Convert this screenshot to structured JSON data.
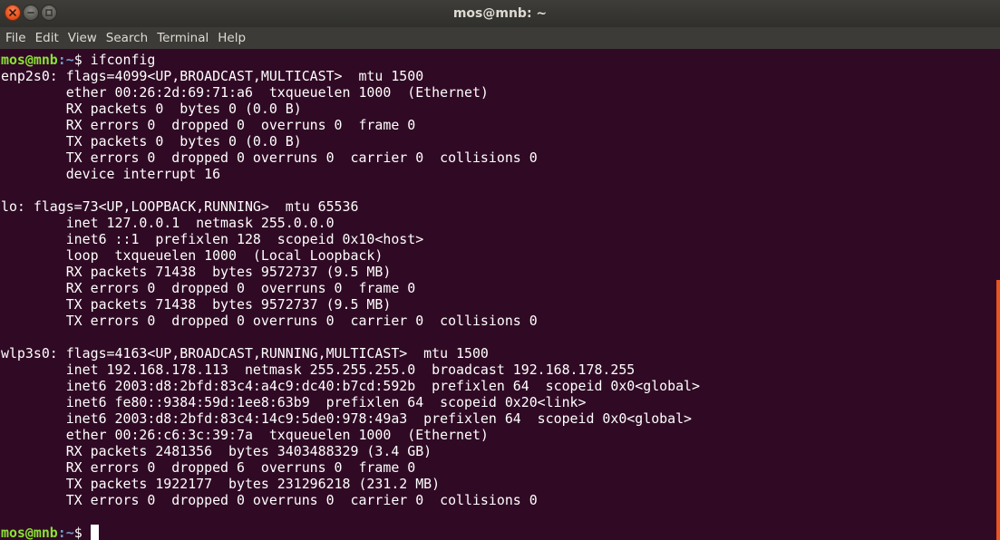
{
  "window": {
    "title": "mos@mnb: ~"
  },
  "menu": [
    "File",
    "Edit",
    "View",
    "Search",
    "Terminal",
    "Help"
  ],
  "prompt": {
    "user_host": "mos@mnb",
    "path": ":~",
    "symbol": "$ "
  },
  "command": "ifconfig",
  "output": [
    "enp2s0: flags=4099<UP,BROADCAST,MULTICAST>  mtu 1500",
    "        ether 00:26:2d:69:71:a6  txqueuelen 1000  (Ethernet)",
    "        RX packets 0  bytes 0 (0.0 B)",
    "        RX errors 0  dropped 0  overruns 0  frame 0",
    "        TX packets 0  bytes 0 (0.0 B)",
    "        TX errors 0  dropped 0 overruns 0  carrier 0  collisions 0",
    "        device interrupt 16",
    "",
    "lo: flags=73<UP,LOOPBACK,RUNNING>  mtu 65536",
    "        inet 127.0.0.1  netmask 255.0.0.0",
    "        inet6 ::1  prefixlen 128  scopeid 0x10<host>",
    "        loop  txqueuelen 1000  (Local Loopback)",
    "        RX packets 71438  bytes 9572737 (9.5 MB)",
    "        RX errors 0  dropped 0  overruns 0  frame 0",
    "        TX packets 71438  bytes 9572737 (9.5 MB)",
    "        TX errors 0  dropped 0 overruns 0  carrier 0  collisions 0",
    "",
    "wlp3s0: flags=4163<UP,BROADCAST,RUNNING,MULTICAST>  mtu 1500",
    "        inet 192.168.178.113  netmask 255.255.255.0  broadcast 192.168.178.255",
    "        inet6 2003:d8:2bfd:83c4:a4c9:dc40:b7cd:592b  prefixlen 64  scopeid 0x0<global>",
    "        inet6 fe80::9384:59d:1ee8:63b9  prefixlen 64  scopeid 0x20<link>",
    "        inet6 2003:d8:2bfd:83c4:14c9:5de0:978:49a3  prefixlen 64  scopeid 0x0<global>",
    "        ether 00:26:c6:3c:39:7a  txqueuelen 1000  (Ethernet)",
    "        RX packets 2481356  bytes 3403488329 (3.4 GB)",
    "        RX errors 0  dropped 6  overruns 0  frame 0",
    "        TX packets 1922177  bytes 231296218 (231.2 MB)",
    "        TX errors 0  dropped 0 overruns 0  carrier 0  collisions 0",
    ""
  ],
  "colors": {
    "terminal_bg": "#300a24",
    "prompt_user": "#8ae234",
    "prompt_path": "#729fcf",
    "close_button": "#e9541e",
    "scrollbar": "#e95420"
  },
  "icons": {
    "close": "close-icon",
    "minimize": "minimize-icon",
    "maximize": "maximize-icon"
  }
}
